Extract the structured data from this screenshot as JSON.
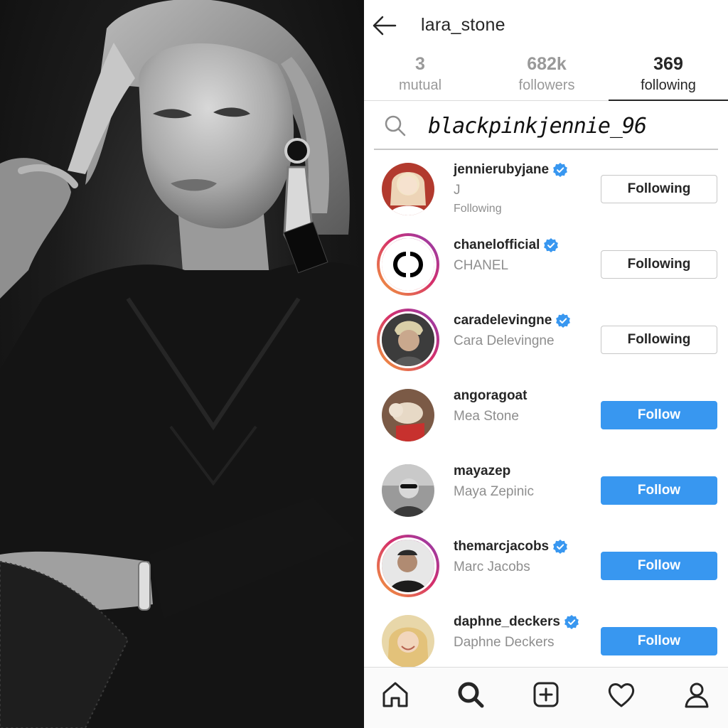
{
  "header": {
    "back_icon": "arrow-left-icon",
    "username": "lara_stone"
  },
  "tabs": [
    {
      "count": "3",
      "label": "mutual",
      "active": false
    },
    {
      "count": "682k",
      "label": "followers",
      "active": false
    },
    {
      "count": "369",
      "label": "following",
      "active": true
    }
  ],
  "search": {
    "icon": "search-icon",
    "value": "blackpinkjennie_96"
  },
  "accounts": [
    {
      "username": "jennierubyjane",
      "verified": true,
      "full_name": "J",
      "note": "Following",
      "button": "Following",
      "button_style": "following",
      "story_ring": false
    },
    {
      "username": "chanelofficial",
      "verified": true,
      "full_name": "CHANEL",
      "note": "",
      "button": "Following",
      "button_style": "following",
      "story_ring": true
    },
    {
      "username": "caradelevingne",
      "verified": true,
      "full_name": "Cara Delevingne",
      "note": "",
      "button": "Following",
      "button_style": "following",
      "story_ring": true
    },
    {
      "username": "angoragoat",
      "verified": false,
      "full_name": "Mea Stone",
      "note": "",
      "button": "Follow",
      "button_style": "follow",
      "story_ring": false
    },
    {
      "username": "mayazep",
      "verified": false,
      "full_name": "Maya Zepinic",
      "note": "",
      "button": "Follow",
      "button_style": "follow",
      "story_ring": false
    },
    {
      "username": "themarcjacobs",
      "verified": true,
      "full_name": "Marc Jacobs",
      "note": "",
      "button": "Follow",
      "button_style": "follow",
      "story_ring": true
    },
    {
      "username": "daphne_deckers",
      "verified": true,
      "full_name": "Daphne Deckers",
      "note": "",
      "button": "Follow",
      "button_style": "follow",
      "story_ring": false
    }
  ],
  "bottom_nav": [
    "home-icon",
    "search-icon",
    "add-post-icon",
    "heart-icon",
    "profile-icon"
  ],
  "colors": {
    "follow_blue": "#3897f0",
    "verified_blue": "#3897f0",
    "text_primary": "#262626",
    "text_secondary": "#8e8e8e"
  }
}
